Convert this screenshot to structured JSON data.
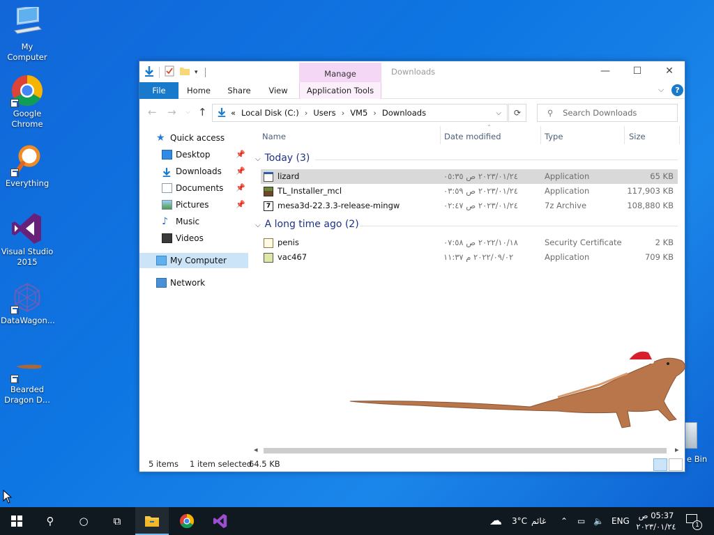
{
  "desktop": {
    "icons": [
      {
        "label": "My Computer"
      },
      {
        "label": "Google Chrome"
      },
      {
        "label": "Everything"
      },
      {
        "label": "Visual Studio 2015"
      },
      {
        "label": "DataWagon..."
      },
      {
        "label": "Bearded Dragon D..."
      }
    ],
    "recycle_partial_label": "e Bin"
  },
  "window": {
    "title": "Downloads",
    "manage_tab": "Manage",
    "ribbon_tabs": [
      "File",
      "Home",
      "Share",
      "View",
      "Application Tools"
    ],
    "address": {
      "overflow": "«",
      "crumbs": [
        "Local Disk (C:)",
        "Users",
        "VM5",
        "Downloads"
      ]
    },
    "search": {
      "placeholder": "Search Downloads"
    },
    "nav": [
      {
        "label": "Quick access"
      },
      {
        "label": "Desktop"
      },
      {
        "label": "Downloads"
      },
      {
        "label": "Documents"
      },
      {
        "label": "Pictures"
      },
      {
        "label": "Music"
      },
      {
        "label": "Videos"
      },
      {
        "label": "My Computer"
      },
      {
        "label": "Network"
      }
    ],
    "columns": [
      "Name",
      "Date modified",
      "Type",
      "Size"
    ],
    "groups": [
      {
        "label": "Today (3)",
        "files": [
          {
            "name": "lizard",
            "date": "٢٠٢٣/٠١/٢٤ ص ٠٥:٣٥",
            "type": "Application",
            "size": "65 KB"
          },
          {
            "name": "TL_Installer_mcl",
            "date": "٢٠٢٣/٠١/٢٤ ص ٠٣:٥٩",
            "type": "Application",
            "size": "117,903 KB"
          },
          {
            "name": "mesa3d-22.3.3-release-mingw",
            "date": "٢٠٢٣/٠١/٢٤ ص ٠٢:٤٧",
            "type": "7z Archive",
            "size": "108,880 KB"
          }
        ]
      },
      {
        "label": "A long time ago (2)",
        "files": [
          {
            "name": "penis",
            "date": "٢٠٢٢/١٠/١٨ ص ٠٧:٥٨",
            "type": "Security Certificate",
            "size": "2 KB"
          },
          {
            "name": "vac467",
            "date": "٢٠٢٢/٠٩/٠٢ م ١١:٣٧",
            "type": "Application",
            "size": "709 KB"
          }
        ]
      }
    ],
    "status": {
      "items": "5 items",
      "selected": "1 item selected",
      "size": "64.5 KB"
    }
  },
  "taskbar": {
    "weather": {
      "temp": "3°C",
      "condition": "غائم"
    },
    "lang": "ENG",
    "time": "05:37 ص",
    "date": "٢٠٢٣/٠١/٢٤",
    "notification_count": "1"
  },
  "colors": {
    "accent": "#1979ca",
    "manage": "#f3d7f5",
    "taskbar": "#101820"
  }
}
